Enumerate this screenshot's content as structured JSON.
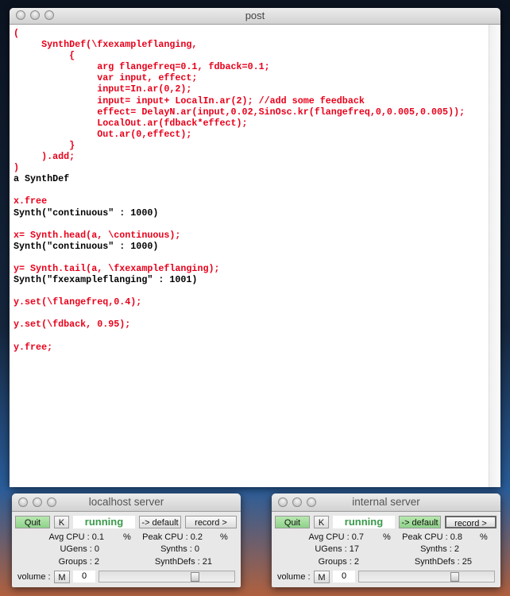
{
  "post": {
    "title": "post",
    "lines": [
      {
        "t": "(",
        "c": "red"
      },
      {
        "t": "     SynthDef(\\fxexampleflanging,",
        "c": "red"
      },
      {
        "t": "          {",
        "c": "red"
      },
      {
        "t": "               arg flangefreq=0.1, fdback=0.1;",
        "c": "red"
      },
      {
        "t": "               var input, effect;",
        "c": "red"
      },
      {
        "t": "               input=In.ar(0,2);",
        "c": "red"
      },
      {
        "t": "               input= input+ LocalIn.ar(2); //add some feedback",
        "c": "red"
      },
      {
        "t": "               effect= DelayN.ar(input,0.02,SinOsc.kr(flangefreq,0,0.005,0.005));",
        "c": "red"
      },
      {
        "t": "               LocalOut.ar(fdback*effect);",
        "c": "red"
      },
      {
        "t": "               Out.ar(0,effect);",
        "c": "red"
      },
      {
        "t": "          }",
        "c": "red"
      },
      {
        "t": "     ).add;",
        "c": "red"
      },
      {
        "t": ")",
        "c": "red"
      },
      {
        "t": "a SynthDef",
        "c": "blk"
      },
      {
        "t": "",
        "c": "blk"
      },
      {
        "t": "x.free",
        "c": "red"
      },
      {
        "t": "Synth(\"continuous\" : 1000)",
        "c": "blk"
      },
      {
        "t": "",
        "c": "blk"
      },
      {
        "t": "x= Synth.head(a, \\continuous);",
        "c": "red"
      },
      {
        "t": "Synth(\"continuous\" : 1000)",
        "c": "blk"
      },
      {
        "t": "",
        "c": "blk"
      },
      {
        "t": "y= Synth.tail(a, \\fxexampleflanging);",
        "c": "red"
      },
      {
        "t": "Synth(\"fxexampleflanging\" : 1001)",
        "c": "blk"
      },
      {
        "t": "",
        "c": "blk"
      },
      {
        "t": "y.set(\\flangefreq,0.4);",
        "c": "red"
      },
      {
        "t": "",
        "c": "blk"
      },
      {
        "t": "y.set(\\fdback, 0.95);",
        "c": "red"
      },
      {
        "t": "",
        "c": "blk"
      },
      {
        "t": "y.free;",
        "c": "red"
      }
    ]
  },
  "servers": [
    {
      "title": "localhost server",
      "quit": "Quit",
      "kill": "K",
      "status": "running",
      "default": "-> default",
      "record": "record >",
      "avg_cpu": "Avg CPU : 0.1",
      "avg_unit": "%",
      "peak_cpu": "Peak CPU : 0.2",
      "peak_unit": "%",
      "ugens": "UGens : 0",
      "synths": "Synths : 0",
      "groups": "Groups : 2",
      "synthdefs": "SynthDefs : 21",
      "volume_label": "volume :",
      "mute": "M",
      "volume": "0",
      "volume_level": 0.72,
      "default_active": false
    },
    {
      "title": "internal server",
      "quit": "Quit",
      "kill": "K",
      "status": "running",
      "default": "-> default",
      "record": "record >",
      "avg_cpu": "Avg CPU : 0.7",
      "avg_unit": "%",
      "peak_cpu": "Peak CPU : 0.8",
      "peak_unit": "%",
      "ugens": "UGens : 17",
      "synths": "Synths : 2",
      "groups": "Groups : 2",
      "synthdefs": "SynthDefs : 25",
      "volume_label": "volume :",
      "mute": "M",
      "volume": "0",
      "volume_level": 0.72,
      "default_active": true
    }
  ]
}
